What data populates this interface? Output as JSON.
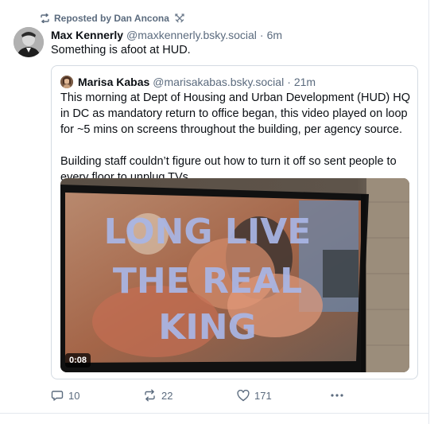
{
  "repost": {
    "label": "Reposted by Dan Ancona",
    "badge_icon": "crossed-swords-icon"
  },
  "post": {
    "author_name": "Max Kennerly",
    "author_handle": "@maxkennerly.bsky.social",
    "separator": "·",
    "time": "6m",
    "text": "Something is afoot at HUD."
  },
  "quote": {
    "author_name": "Marisa Kabas",
    "author_handle": "@marisakabas.bsky.social",
    "separator": "·",
    "time": "21m",
    "lines": [
      "This morning at Dept of Housing and Urban Development (HUD) HQ",
      "in DC as mandatory return to office began, this video played on loop",
      "for ~5 mins on screens throughout the building, per agency source.",
      "",
      "Building staff couldn’t figure out how to turn it off so sent people to",
      "every floor to unplug TVs."
    ],
    "video": {
      "overlay_line1": "LONG LIVE",
      "overlay_line2": "THE REAL",
      "overlay_line3": "KING",
      "duration": "0:08"
    }
  },
  "actions": {
    "reply_count": "10",
    "repost_count": "22",
    "like_count": "171",
    "more_label": "···"
  },
  "colors": {
    "text_primary": "#0b0f14",
    "text_secondary": "#5b6b7e",
    "border": "#d4dbe2"
  }
}
